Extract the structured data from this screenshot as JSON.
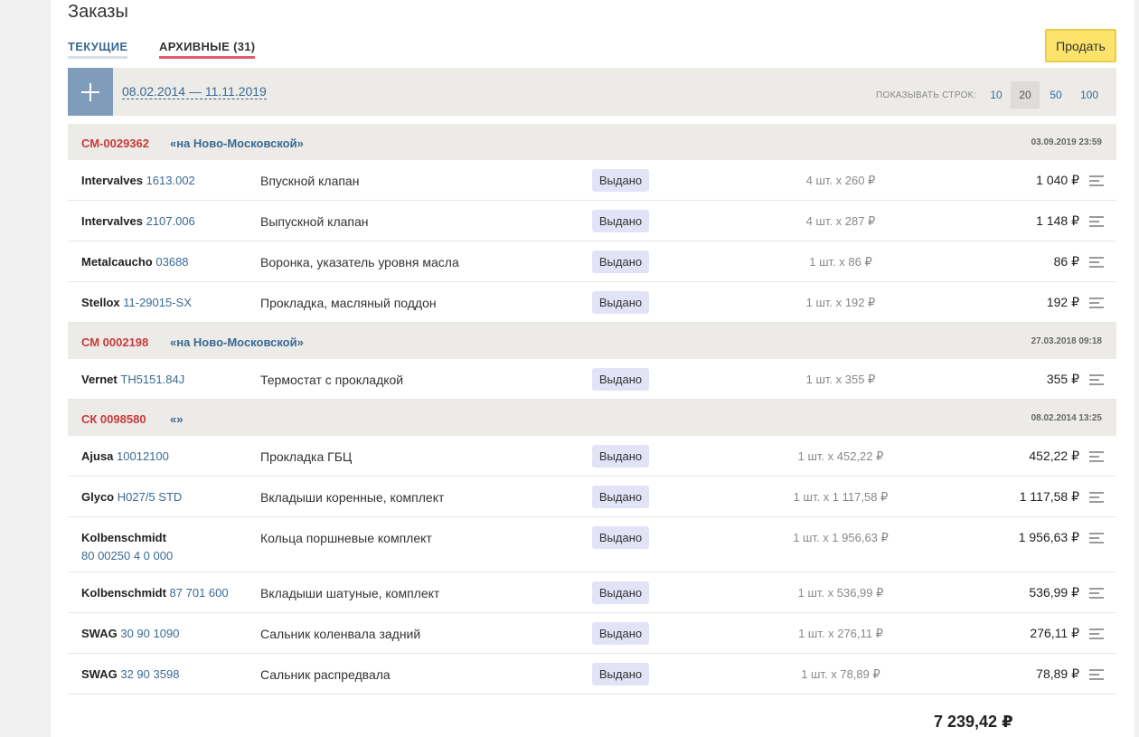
{
  "page": {
    "title": "Заказы"
  },
  "tabs": {
    "current": "ТЕКУЩИЕ",
    "archive": "АРХИВНЫЕ (31)"
  },
  "toolbar": {
    "sell_label": "Продать",
    "date_range": "08.02.2014 — 11.11.2019",
    "rows_label": "ПОКАЗЫВАТЬ СТРОК:",
    "rows_options": [
      "10",
      "20",
      "50",
      "100"
    ],
    "rows_selected": "20"
  },
  "orders": [
    {
      "number": "СМ-0029362",
      "store": "«на Ново-Московской»",
      "date": "03.09.2019 23:59",
      "items": [
        {
          "brand": "Intervalves",
          "code": "1613.002",
          "desc": "Впускной клапан",
          "status": "Выдано",
          "qty": "4 шт. x 260 ₽",
          "sum": "1 040 ₽"
        },
        {
          "brand": "Intervalves",
          "code": "2107.006",
          "desc": "Выпускной клапан",
          "status": "Выдано",
          "qty": "4 шт. x 287 ₽",
          "sum": "1 148 ₽"
        },
        {
          "brand": "Metalcaucho",
          "code": "03688",
          "desc": "Воронка, указатель уровня масла",
          "status": "Выдано",
          "qty": "1 шт. x 86 ₽",
          "sum": "86 ₽"
        },
        {
          "brand": "Stellox",
          "code": "11-29015-SX",
          "desc": "Прокладка, масляный поддон",
          "status": "Выдано",
          "qty": "1 шт. x 192 ₽",
          "sum": "192 ₽"
        }
      ]
    },
    {
      "number": "СМ 0002198",
      "store": "«на Ново-Московской»",
      "date": "27.03.2018 09:18",
      "items": [
        {
          "brand": "Vernet",
          "code": "TH5151.84J",
          "desc": "Термостат с прокладкой",
          "status": "Выдано",
          "qty": "1 шт. x 355 ₽",
          "sum": "355 ₽"
        }
      ]
    },
    {
      "number": "СК 0098580",
      "store": "«»",
      "date": "08.02.2014 13:25",
      "items": [
        {
          "brand": "Ajusa",
          "code": "10012100",
          "desc": "Прокладка ГБЦ",
          "status": "Выдано",
          "qty": "1 шт. x 452,22 ₽",
          "sum": "452,22 ₽"
        },
        {
          "brand": "Glyco",
          "code": "H027/5 STD",
          "desc": "Вкладыши коренные, комплект",
          "status": "Выдано",
          "qty": "1 шт. x 1 117,58 ₽",
          "sum": "1 117,58 ₽"
        },
        {
          "brand": "Kolbenschmidt",
          "code": "80 00250 4 0 000",
          "desc": "Кольца поршневые комплект",
          "status": "Выдано",
          "qty": "1 шт. x 1 956,63 ₽",
          "sum": "1 956,63 ₽",
          "wrap": true
        },
        {
          "brand": "Kolbenschmidt",
          "code": "87 701 600",
          "desc": "Вкладыши шатуные, комплект",
          "status": "Выдано",
          "qty": "1 шт. x 536,99 ₽",
          "sum": "536,99 ₽"
        },
        {
          "brand": "SWAG",
          "code": "30 90 1090",
          "desc": "Сальник коленвала задний",
          "status": "Выдано",
          "qty": "1 шт. x 276,11 ₽",
          "sum": "276,11 ₽"
        },
        {
          "brand": "SWAG",
          "code": "32 90 3598",
          "desc": "Сальник распредвала",
          "status": "Выдано",
          "qty": "1 шт. x 78,89 ₽",
          "sum": "78,89 ₽"
        }
      ]
    }
  ],
  "summary": {
    "total": "7 239,42 ₽"
  }
}
